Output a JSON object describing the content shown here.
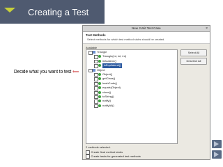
{
  "slide": {
    "title": "Creating a Test",
    "side_label": "Decide what you want to test",
    "cursor_glyph": "⟸"
  },
  "dialog": {
    "window_title": "New JUnit Test Case",
    "header_title": "Test Methods",
    "header_desc": "Select methods for which test method stubs should be created.",
    "available_label": "Available",
    "tree": [
      {
        "label": "Triangle",
        "indent": 0,
        "type": "class"
      },
      {
        "label": "Triangle(int, int, int)",
        "indent": 1,
        "type": "method"
      },
      {
        "label": "isScalene()",
        "indent": 1,
        "type": "method"
      },
      {
        "label": "isEquilateral()",
        "indent": 1,
        "type": "method",
        "selected": true
      },
      {
        "label": "Object",
        "indent": 0,
        "type": "class"
      },
      {
        "label": "Object()",
        "indent": 1,
        "type": "method"
      },
      {
        "label": "getClass()",
        "indent": 1,
        "type": "method"
      },
      {
        "label": "hashCode()",
        "indent": 1,
        "type": "method"
      },
      {
        "label": "equals(Object)",
        "indent": 1,
        "type": "method"
      },
      {
        "label": "clone()",
        "indent": 1,
        "type": "method"
      },
      {
        "label": "toString()",
        "indent": 1,
        "type": "method"
      },
      {
        "label": "notify()",
        "indent": 1,
        "type": "method"
      },
      {
        "label": "notifyAll()",
        "indent": 1,
        "type": "method"
      }
    ],
    "select_all": "Select All",
    "deselect_all": "Deselect All",
    "methods_selected": "2 methods selected.",
    "option_final": "Create final method stubs",
    "option_tasks": "Create tasks for generated test methods"
  }
}
